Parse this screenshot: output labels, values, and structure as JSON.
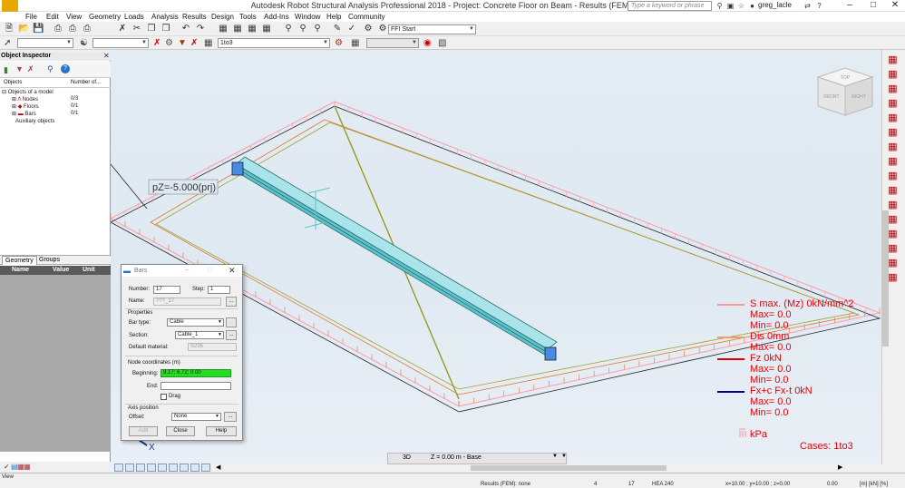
{
  "titlebar": {
    "title": "Autodesk Robot Structural Analysis Professional 2018 - Project: Concrete Floor on Beam - Results (FEM): none",
    "logo_text": "PRO",
    "search_placeholder": "Type a keyword or phrase",
    "user": "greg_lacle"
  },
  "menu": [
    "File",
    "Edit",
    "View",
    "Geometry",
    "Loads",
    "Analysis",
    "Results",
    "Design",
    "Tools",
    "Add-Ins",
    "Window",
    "Help",
    "Community"
  ],
  "toolbar": {
    "layout_combo": "FFI Start",
    "case_combo": "1to3"
  },
  "object_inspector": {
    "title": "Object Inspector",
    "col_objects": "Objects",
    "col_number": "Number of...",
    "tree": [
      {
        "label": "Objects of a model",
        "value": ""
      },
      {
        "label": "Nodes",
        "value": "0/3"
      },
      {
        "label": "Floors",
        "value": "0/1"
      },
      {
        "label": "Bars",
        "value": "0/1"
      },
      {
        "label": "Auxiliary objects",
        "value": ""
      }
    ],
    "tabs": [
      "Geometry",
      "Groups"
    ],
    "prop_cols": [
      "Name",
      "Value",
      "Unit"
    ]
  },
  "viewport": {
    "load_label": "pZ=-5.000(prj)",
    "axis_x": "X",
    "viewcube": [
      "TOP",
      "FRONT",
      "RIGHT"
    ],
    "legend": [
      {
        "text": "S max. (Mz) 0kN/mm^2",
        "color": "#ff9999"
      },
      {
        "text": "Max=    0.0",
        "color": ""
      },
      {
        "text": "Min=    0.0",
        "color": ""
      },
      {
        "text": "Dis  0mm",
        "color": "#f0a060"
      },
      {
        "text": "Max=    0.0",
        "color": ""
      },
      {
        "text": "Fz  0kN",
        "color": "#e00000"
      },
      {
        "text": "Max=    0.0",
        "color": ""
      },
      {
        "text": "Min=    0.0",
        "color": ""
      },
      {
        "text": "Fx+c Fx-t  0kN",
        "color": "#0000a0"
      },
      {
        "text": "Max=    0.0",
        "color": ""
      },
      {
        "text": "Min=    0.0",
        "color": ""
      }
    ],
    "kpa_label": "kPa",
    "cases_label": "Cases: 1to3",
    "view_mode": "3D",
    "level_value": "Z = 0.00 m - Base"
  },
  "bars_dialog": {
    "title": "Bars",
    "number_label": "Number:",
    "number_value": "17",
    "step_label": "Step:",
    "step_value": "1",
    "name_label": "Name:",
    "name_value": "???_17",
    "browse": "...",
    "properties_label": "Properties",
    "bar_type_label": "Bar type:",
    "bar_type_value": "Cable",
    "section_label": "Section:",
    "section_value": "Cable_1",
    "material_label": "Default material:",
    "material_value": "S235",
    "node_coords_label": "Node coordinates (m)",
    "beginning_label": "Beginning:",
    "beginning_value": "9.17; 6.72; 0.00",
    "end_label": "End:",
    "end_value": "",
    "drag_label": "Drag",
    "axis_pos_label": "Axis position",
    "offset_label": "Offset:",
    "offset_value": "None",
    "add_label": "Add",
    "close_label": "Close",
    "help_label": "Help"
  },
  "statusbar": {
    "view_label": "View",
    "results": "Results (FEM): none",
    "n1": "4",
    "n2": "17",
    "section": "HEA 240",
    "coords": "x=10.00 ; y=10.00 ; z=0.00",
    "value": "0.00",
    "units": "[m] [kN] [%]"
  },
  "colors": {
    "beam": "#5ec4cc",
    "slab_outline": "#222222",
    "load_pink": "#ff8aa0",
    "load_orange": "#e07830",
    "diagonal": "#9a9a20",
    "highlight_green": "#22dd22"
  }
}
